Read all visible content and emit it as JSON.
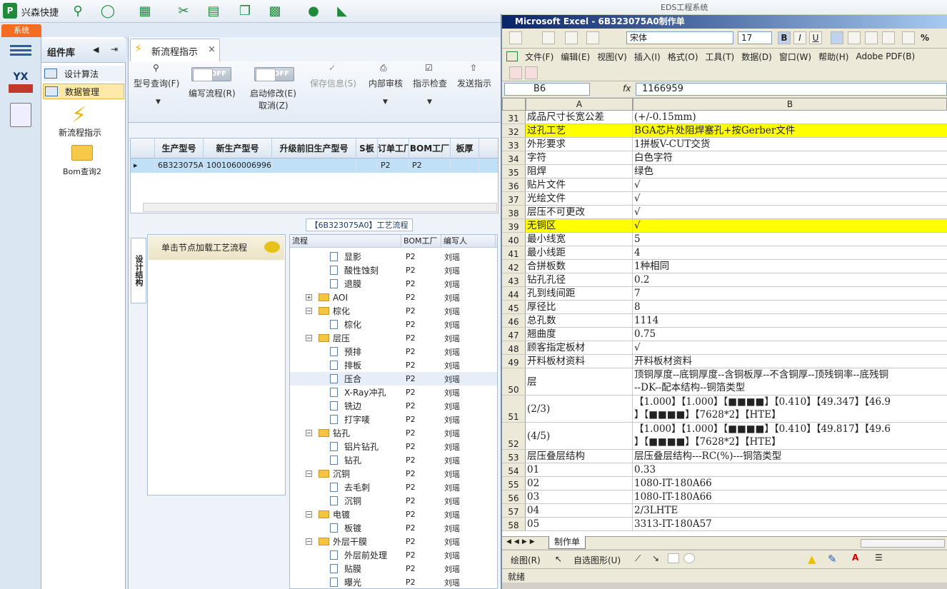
{
  "app": {
    "title": "兴森快捷",
    "window_title": "EDS工程系统"
  },
  "system_tab": "系统",
  "component_panel": {
    "title": "组件库",
    "items": [
      {
        "label": "设计算法"
      },
      {
        "label": "数据管理"
      }
    ],
    "tools": [
      {
        "label": "新流程指示"
      },
      {
        "label": "Bom查询2"
      }
    ]
  },
  "tab": {
    "label": "新流程指示"
  },
  "ribbon": {
    "model_query": "型号查询(F)",
    "edit_flow": "编写流程(R)",
    "start_modify": "启动修改(E)",
    "cancel": "取消(Z)",
    "save_info": "保存信息(S)",
    "internal_review": "内部审核",
    "instruction_check": "指示检查",
    "send_instruction": "发送指示",
    "toggle_off": "OFF"
  },
  "grid": {
    "headers": [
      "生产型号",
      "新生产型号",
      "升级前旧生产型号",
      "S板",
      "订单工厂",
      "BOM工厂",
      "板厚"
    ],
    "row": [
      "6B323075A0",
      "10010600069969",
      "",
      "",
      "P2",
      "P2",
      ""
    ]
  },
  "process": {
    "caption": "【6B323075A0】工艺流程",
    "side_tab": "设计结构",
    "hint": "单击节点加载工艺流程",
    "headers": [
      "流程",
      "BOM工厂",
      "编写人"
    ],
    "nodes": [
      {
        "name": "显影",
        "factory": "P2",
        "author": "刘瑶"
      },
      {
        "name": "酸性蚀刻",
        "factory": "P2",
        "author": "刘瑶"
      },
      {
        "name": "退膜",
        "factory": "P2",
        "author": "刘瑶"
      },
      {
        "name": "AOI",
        "factory": "P2",
        "author": "刘瑶"
      },
      {
        "name": "棕化",
        "factory": "P2",
        "author": "刘瑶"
      },
      {
        "name": "棕化",
        "factory": "P2",
        "author": "刘瑶"
      },
      {
        "name": "层压",
        "factory": "P2",
        "author": "刘瑶"
      },
      {
        "name": "预排",
        "factory": "P2",
        "author": "刘瑶"
      },
      {
        "name": "排板",
        "factory": "P2",
        "author": "刘瑶"
      },
      {
        "name": "压合",
        "factory": "P2",
        "author": "刘瑶"
      },
      {
        "name": "X-Ray冲孔",
        "factory": "P2",
        "author": "刘瑶"
      },
      {
        "name": "铣边",
        "factory": "P2",
        "author": "刘瑶"
      },
      {
        "name": "打字唛",
        "factory": "P2",
        "author": "刘瑶"
      },
      {
        "name": "钻孔",
        "factory": "P2",
        "author": "刘瑶"
      },
      {
        "name": "铝片钻孔",
        "factory": "P2",
        "author": "刘瑶"
      },
      {
        "name": "钻孔",
        "factory": "P2",
        "author": "刘瑶"
      },
      {
        "name": "沉铜",
        "factory": "P2",
        "author": "刘瑶"
      },
      {
        "name": "去毛刺",
        "factory": "P2",
        "author": "刘瑶"
      },
      {
        "name": "沉铜",
        "factory": "P2",
        "author": "刘瑶"
      },
      {
        "name": "电镀",
        "factory": "P2",
        "author": "刘瑶"
      },
      {
        "name": "板镀",
        "factory": "P2",
        "author": "刘瑶"
      },
      {
        "name": "外层干膜",
        "factory": "P2",
        "author": "刘瑶"
      },
      {
        "name": "外层前处理",
        "factory": "P2",
        "author": "刘瑶"
      },
      {
        "name": "贴膜",
        "factory": "P2",
        "author": "刘瑶"
      },
      {
        "name": "曝光",
        "factory": "P2",
        "author": "刘瑶"
      }
    ]
  },
  "excel": {
    "title": "Microsoft Excel - 6B323075A0制作单",
    "font_name": "宋体",
    "font_size": "17",
    "menu": [
      "文件(F)",
      "编辑(E)",
      "视图(V)",
      "插入(I)",
      "格式(O)",
      "工具(T)",
      "数据(D)",
      "窗口(W)",
      "帮助(H)",
      "Adobe PDF(B)"
    ],
    "cell_ref": "B6",
    "fx": "fx",
    "formula": "1166959",
    "col_a": "A",
    "col_b": "B",
    "rows": [
      {
        "n": "31",
        "a": "成品尺寸长宽公差",
        "b": "(+/-0.15mm)"
      },
      {
        "n": "32",
        "a": "过孔工艺",
        "b": "BGA芯片处阻焊塞孔+按Gerber文件"
      },
      {
        "n": "33",
        "a": "外形要求",
        "b": "1拼板V-CUT交货"
      },
      {
        "n": "34",
        "a": "字符",
        "b": "白色字符"
      },
      {
        "n": "35",
        "a": "阻焊",
        "b": "绿色"
      },
      {
        "n": "36",
        "a": "贴片文件",
        "b": "√"
      },
      {
        "n": "37",
        "a": "光绘文件",
        "b": "√"
      },
      {
        "n": "38",
        "a": "层压不可更改",
        "b": "√"
      },
      {
        "n": "39",
        "a": "无铜区",
        "b": "√"
      },
      {
        "n": "40",
        "a": "最小线宽",
        "b": "5"
      },
      {
        "n": "41",
        "a": "最小线距",
        "b": "4"
      },
      {
        "n": "42",
        "a": "合拼板数",
        "b": "1种相同"
      },
      {
        "n": "43",
        "a": "钻孔孔径",
        "b": "0.2"
      },
      {
        "n": "44",
        "a": "孔到线间距",
        "b": "7"
      },
      {
        "n": "45",
        "a": "厚径比",
        "b": "8"
      },
      {
        "n": "46",
        "a": "总孔数",
        "b": "1114"
      },
      {
        "n": "47",
        "a": "翘曲度",
        "b": "0.75"
      },
      {
        "n": "48",
        "a": "顾客指定板材",
        "b": "√"
      },
      {
        "n": "49",
        "a": "开料板材资料",
        "b": "开料板材资料"
      },
      {
        "n": "50",
        "a": "层",
        "b": "顶铜厚度--底铜厚度--含铜板厚--不含铜厚--顶残铜率--底残铜",
        "b2": "--DK--配本结构--铜箔类型"
      },
      {
        "n": "51",
        "a": "(2/3)",
        "b": "【1.000】【1.000】【■■■■】【0.410】【49.347】【46.9",
        "b2": "】【■■■■】【7628*2】【HTE】"
      },
      {
        "n": "52",
        "a": "(4/5)",
        "b": "【1.000】【1.000】【■■■■】【0.410】【49.817】【49.6",
        "b2": "】【■■■■】【7628*2】【HTE】"
      },
      {
        "n": "53",
        "a": "层压叠层结构",
        "b": "层压叠层结构---RC(%)---铜箔类型"
      },
      {
        "n": "54",
        "a": "01",
        "b": "0.33"
      },
      {
        "n": "55",
        "a": "02",
        "b": "1080-IT-180A66"
      },
      {
        "n": "56",
        "a": "03",
        "b": "1080-IT-180A66"
      },
      {
        "n": "57",
        "a": "04",
        "b": "2/3LHTE"
      },
      {
        "n": "58",
        "a": "05",
        "b": "3313-IT-180A57"
      }
    ],
    "sheet_tab": "制作单",
    "draw_label": "绘图(R)",
    "autoshape_label": "自选图形(U)",
    "status": "就绪"
  }
}
